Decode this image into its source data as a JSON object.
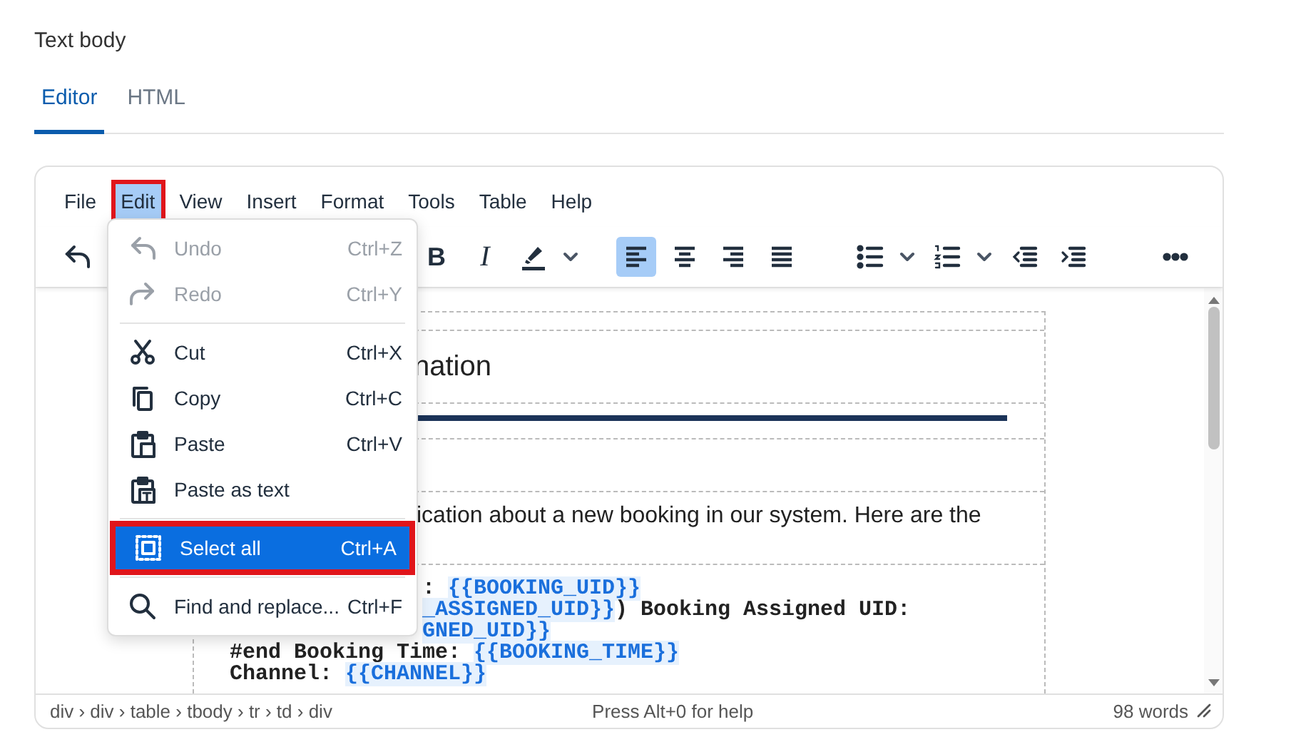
{
  "field_label": "Text body",
  "tabs": [
    {
      "label": "Editor",
      "selected": true
    },
    {
      "label": "HTML",
      "selected": false
    }
  ],
  "menubar": {
    "items": [
      {
        "label": "File",
        "selected": false,
        "annotated": false
      },
      {
        "label": "Edit",
        "selected": true,
        "annotated": true
      },
      {
        "label": "View",
        "selected": false,
        "annotated": false
      },
      {
        "label": "Insert",
        "selected": false,
        "annotated": false
      },
      {
        "label": "Format",
        "selected": false,
        "annotated": false
      },
      {
        "label": "Tools",
        "selected": false,
        "annotated": false
      },
      {
        "label": "Table",
        "selected": false,
        "annotated": false
      },
      {
        "label": "Help",
        "selected": false,
        "annotated": false
      }
    ]
  },
  "toolbar": {
    "bold_label": "B",
    "italic_label": "I",
    "alignment": [
      {
        "selected": true
      },
      {
        "selected": false
      },
      {
        "selected": false
      },
      {
        "selected": false
      }
    ]
  },
  "edit_menu": {
    "items": [
      {
        "kind": "item",
        "label": "Undo",
        "shortcut": "Ctrl+Z",
        "disabled": true,
        "selected": false,
        "annotated": false
      },
      {
        "kind": "item",
        "label": "Redo",
        "shortcut": "Ctrl+Y",
        "disabled": true,
        "selected": false,
        "annotated": false
      },
      {
        "kind": "separator"
      },
      {
        "kind": "item",
        "label": "Cut",
        "shortcut": "Ctrl+X",
        "disabled": false,
        "selected": false,
        "annotated": false
      },
      {
        "kind": "item",
        "label": "Copy",
        "shortcut": "Ctrl+C",
        "disabled": false,
        "selected": false,
        "annotated": false
      },
      {
        "kind": "item",
        "label": "Paste",
        "shortcut": "Ctrl+V",
        "disabled": false,
        "selected": false,
        "annotated": false
      },
      {
        "kind": "item",
        "label": "Paste as text",
        "disabled": false,
        "selected": false,
        "annotated": false
      },
      {
        "kind": "separator"
      },
      {
        "kind": "item",
        "label": "Select all",
        "shortcut": "Ctrl+A",
        "disabled": false,
        "selected": true,
        "annotated": true
      },
      {
        "kind": "separator"
      },
      {
        "kind": "item",
        "label": "Find and replace...",
        "shortcut": "Ctrl+F",
        "disabled": false,
        "selected": false,
        "annotated": false
      }
    ]
  },
  "document": {
    "heading": "nation",
    "paragraph": "ication about a new booking in our system. Here are the",
    "code_lines_beside_menu": [
      {
        "segments": [
          {
            "kind": "text",
            "text": ": "
          },
          {
            "kind": "variable",
            "text": "{{BOOKING_UID}}"
          }
        ]
      },
      {
        "segments": [
          {
            "kind": "variable",
            "text": "_ASSIGNED_UID}}"
          },
          {
            "kind": "text",
            "text": ") Booking Assigned UID:"
          }
        ]
      },
      {
        "segments": [
          {
            "kind": "variable",
            "text": "GNED_UID}}"
          }
        ]
      }
    ],
    "code_lines": [
      {
        "segments": [
          {
            "kind": "text",
            "text": "#end Booking Time: "
          },
          {
            "kind": "variable",
            "text": "{{BOOKING_TIME}}"
          }
        ]
      },
      {
        "segments": [
          {
            "kind": "text",
            "text": "Channel: "
          },
          {
            "kind": "variable",
            "text": "{{CHANNEL}}"
          }
        ]
      }
    ]
  },
  "status_bar": {
    "path": "div › div › table › tbody › tr › td › div",
    "help": "Press Alt+0 for help",
    "word_count": "98 words"
  }
}
